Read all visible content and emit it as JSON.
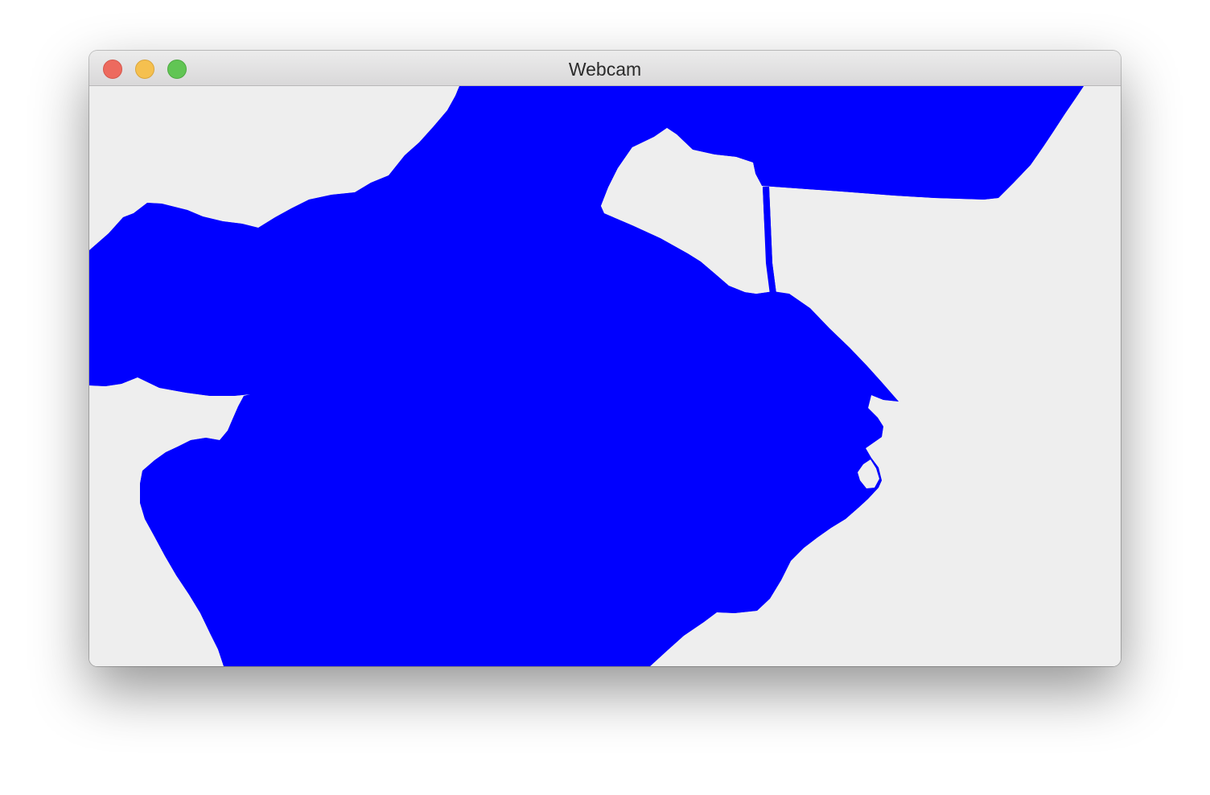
{
  "window": {
    "title": "Webcam",
    "controls": {
      "close": "close-button",
      "minimize": "minimize-button",
      "zoom": "zoom-button"
    }
  },
  "frame": {
    "background_color": "#eeeeee",
    "mask_color": "#0000ff"
  }
}
